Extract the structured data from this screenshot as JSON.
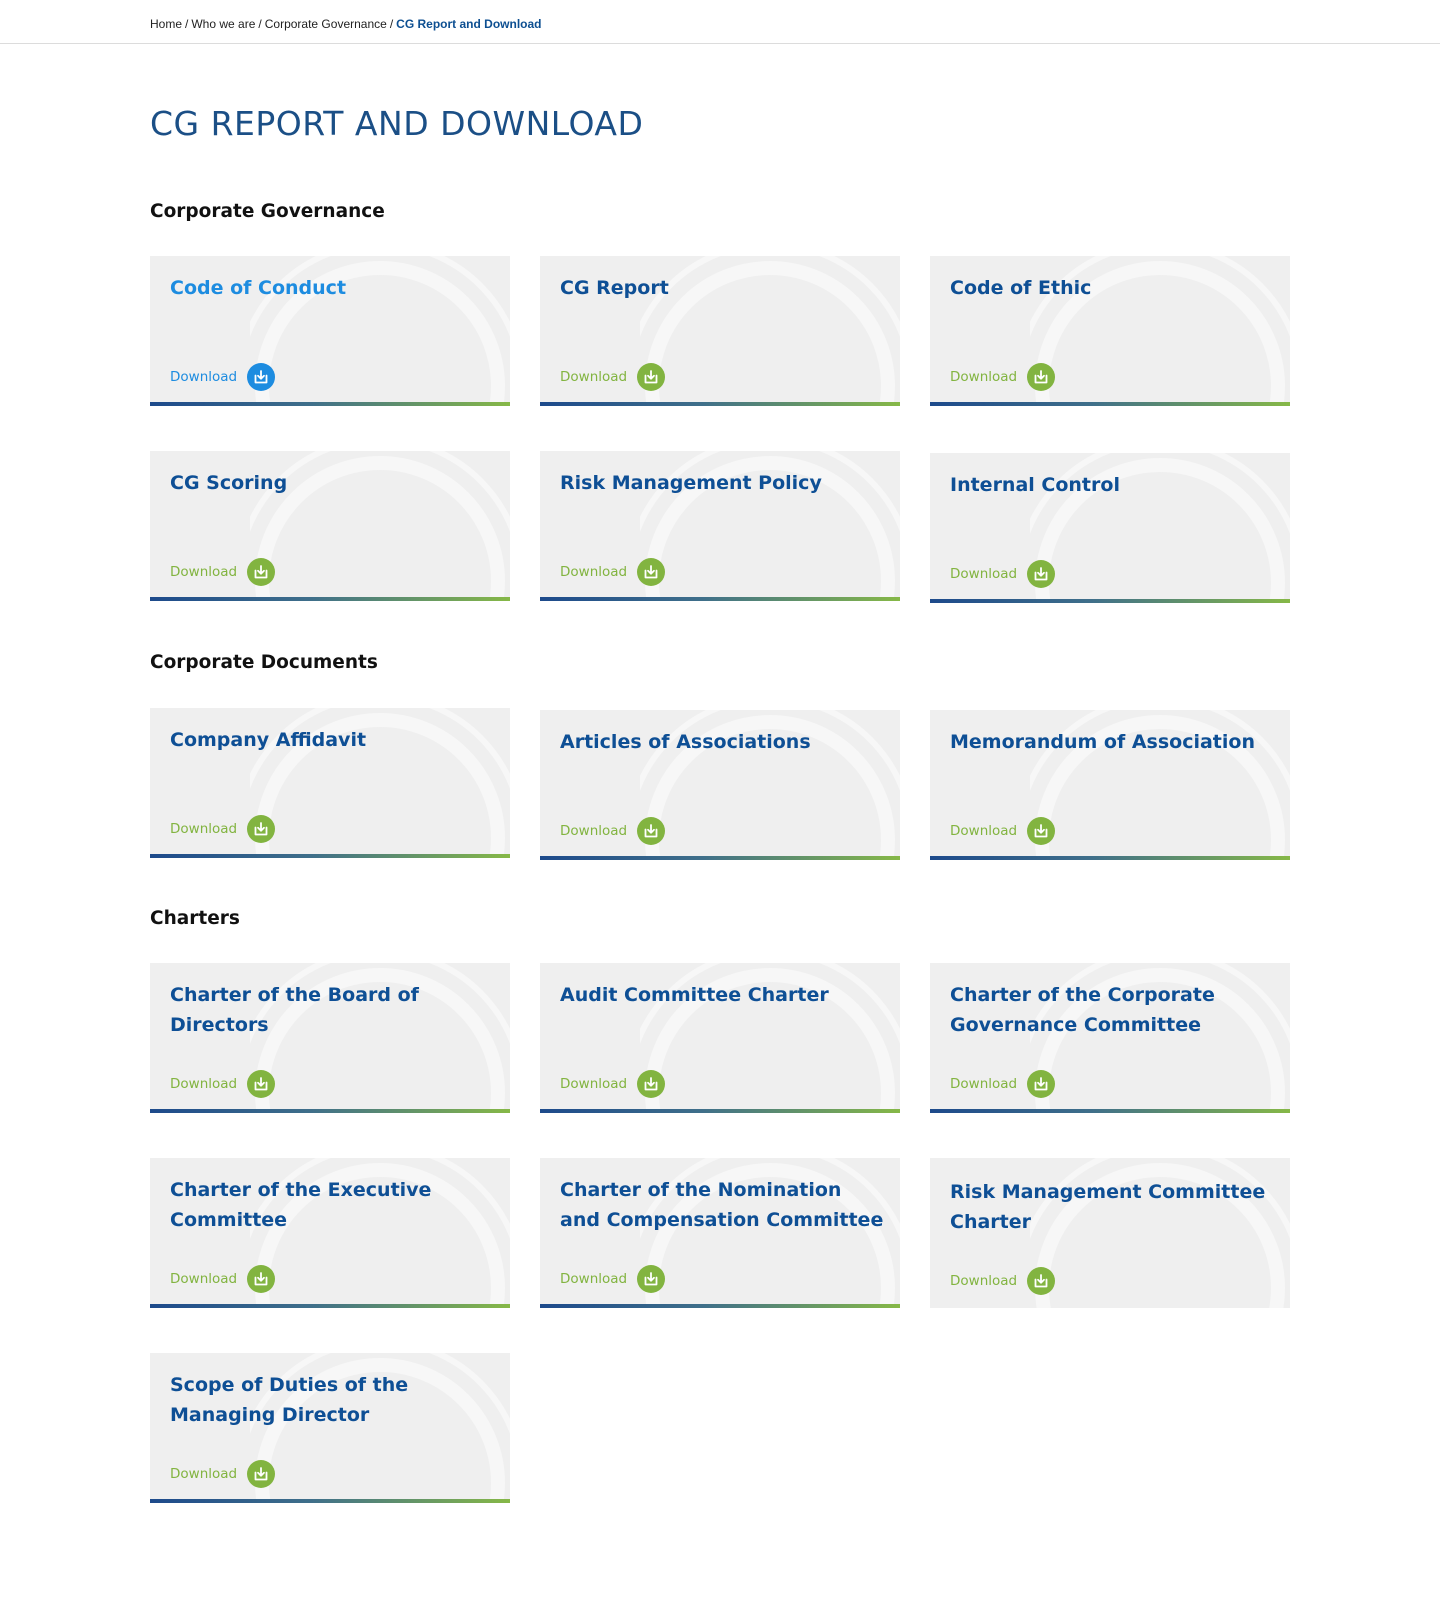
{
  "breadcrumb": {
    "home": "Home",
    "sep": "/",
    "who_we_are": "Who we are",
    "corporate_governance": "Corporate Governance",
    "current": "CG Report and Download"
  },
  "page_title": "CG REPORT AND DOWNLOAD",
  "download_label": "Download",
  "sections": {
    "governance": {
      "title": "Corporate Governance",
      "cards": [
        {
          "title": "Code of Conduct"
        },
        {
          "title": "CG Report"
        },
        {
          "title": "Code of Ethic"
        },
        {
          "title": "CG Scoring"
        },
        {
          "title": "Risk Management Policy"
        },
        {
          "title": "Internal Control"
        }
      ]
    },
    "documents": {
      "title": "Corporate Documents",
      "cards": [
        {
          "title": "Company Affidavit"
        },
        {
          "title": "Articles of Associations"
        },
        {
          "title": "Memorandum of Association"
        }
      ]
    },
    "charters": {
      "title": "Charters",
      "cards": [
        {
          "title": "Charter of the Board of Directors"
        },
        {
          "title": "Audit Committee Charter"
        },
        {
          "title": "Charter of the Corporate Governance Committee"
        },
        {
          "title": "Charter of the Executive Committee"
        },
        {
          "title": "Charter of the Nomination and Compensation Committee"
        },
        {
          "title": "Risk Management Committee Charter"
        },
        {
          "title": "Scope of Duties of the Managing Director"
        }
      ]
    }
  },
  "colors": {
    "title_blue": "#1b4f86",
    "card_title": "#0e4f95",
    "active_blue": "#1d8ce0",
    "download_green": "#82b440",
    "card_bg": "#efefef",
    "bar_start": "#1d4a8b",
    "bar_end": "#86b847"
  }
}
